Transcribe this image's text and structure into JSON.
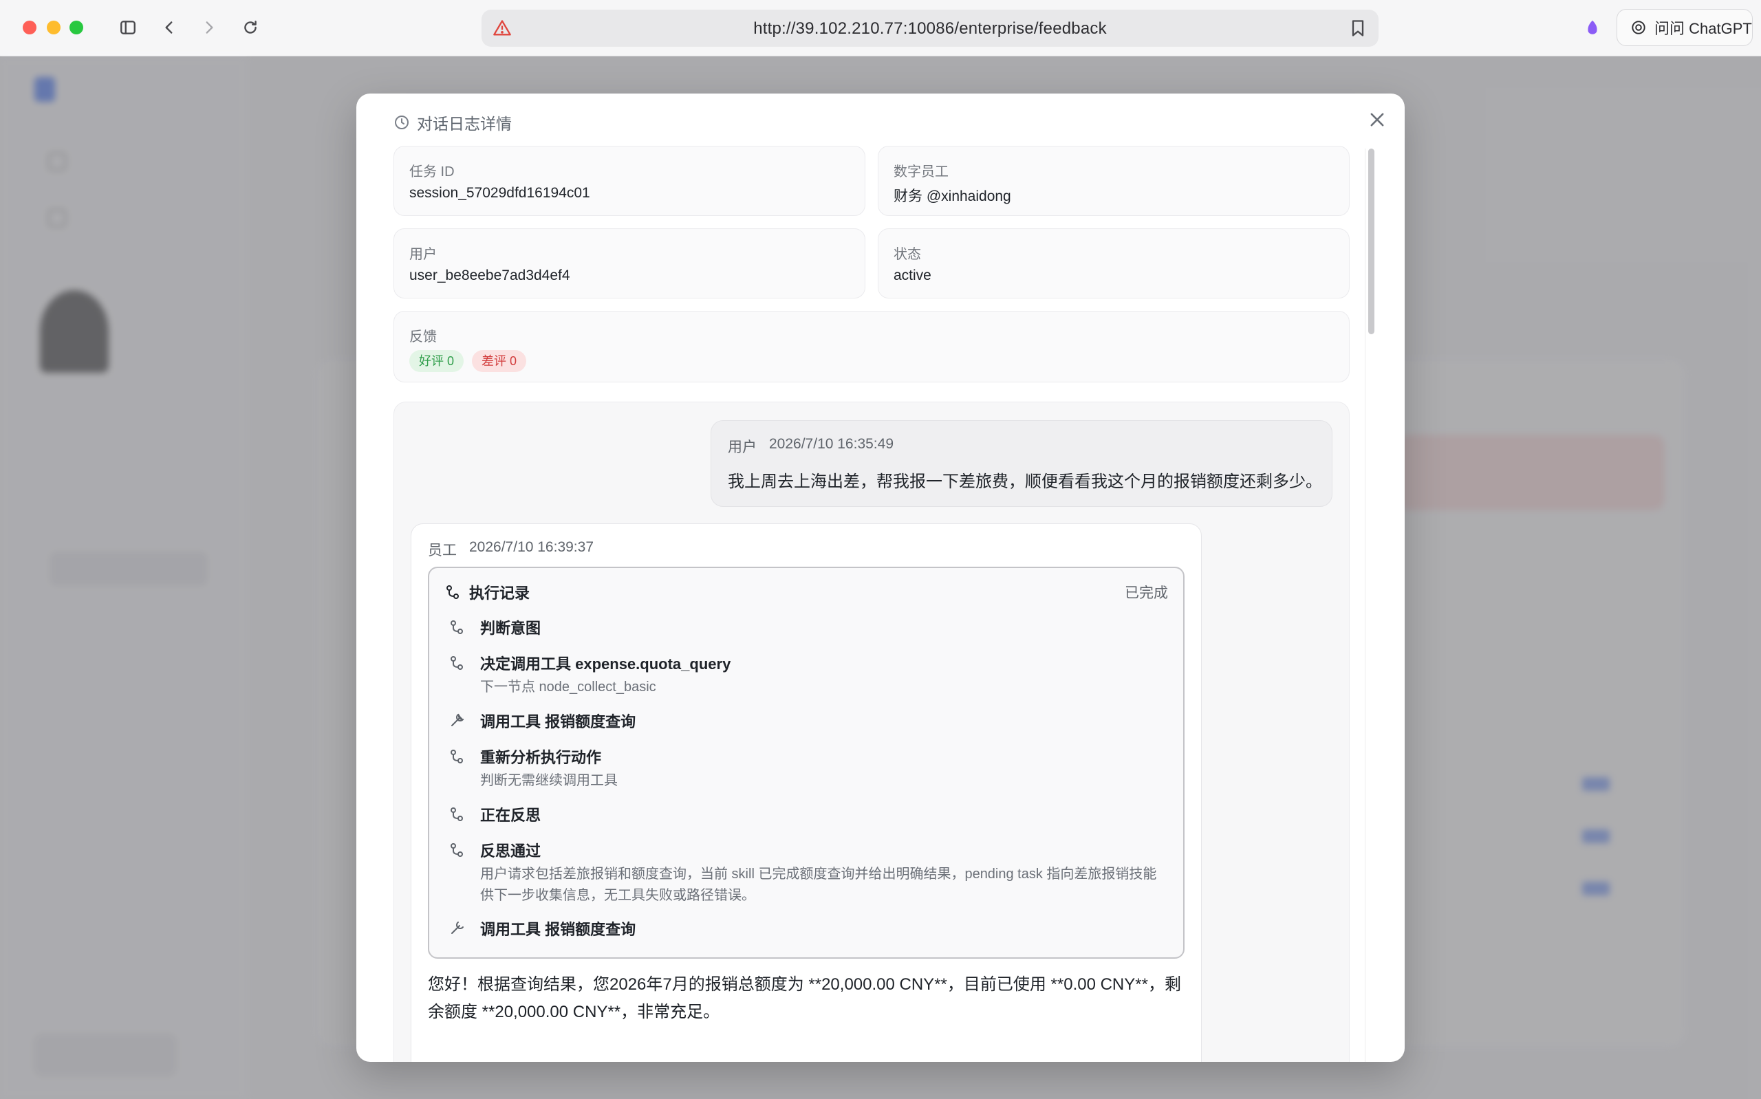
{
  "browser": {
    "url": "http://39.102.210.77:10086/enterprise/feedback",
    "chatgpt_label": "问问 ChatGPT"
  },
  "icons": {
    "sidebar_toggle": "sidebar-icon",
    "back": "chevron-left-icon",
    "forward": "chevron-right-icon",
    "reload": "reload-icon",
    "warning": "warning-triangle-icon",
    "bookmark": "bookmark-icon",
    "close": "close-icon",
    "clock": "clock-icon",
    "branch": "branch-icon",
    "wrench": "wrench-icon"
  },
  "modal": {
    "title": "对话日志详情",
    "fields": {
      "task_id_label": "任务 ID",
      "task_id_value": "session_57029dfd16194c01",
      "employee_label": "数字员工",
      "employee_value": "财务 @xinhaidong",
      "user_label": "用户",
      "user_value": "user_be8eebe7ad3d4ef4",
      "status_label": "状态",
      "status_value": "active",
      "feedback_label": "反馈",
      "good_badge": "好评 0",
      "bad_badge": "差评 0"
    },
    "user_message": {
      "role": "用户",
      "time": "2026/7/10 16:35:49",
      "text": "我上周去上海出差，帮我报一下差旅费，顺便看看我这个月的报销额度还剩多少。"
    },
    "agent_message": {
      "role": "员工",
      "time": "2026/7/10 16:39:37",
      "exec_title": "执行记录",
      "exec_status": "已完成",
      "steps": [
        {
          "icon": "branch-icon",
          "title": "判断意图",
          "desc": ""
        },
        {
          "icon": "branch-icon",
          "title": "决定调用工具 expense.quota_query",
          "desc": "下一节点 node_collect_basic"
        },
        {
          "icon": "wrench-icon",
          "title": "调用工具 报销额度查询",
          "desc": ""
        },
        {
          "icon": "branch-icon",
          "title": "重新分析执行动作",
          "desc": "判断无需继续调用工具"
        },
        {
          "icon": "branch-icon",
          "title": "正在反思",
          "desc": ""
        },
        {
          "icon": "branch-icon",
          "title": "反思通过",
          "desc": "用户请求包括差旅报销和额度查询，当前 skill 已完成额度查询并给出明确结果，pending task 指向差旅报销技能供下一步收集信息，无工具失败或路径错误。"
        },
        {
          "icon": "wrench-icon",
          "title": "调用工具 报销额度查询",
          "desc": ""
        }
      ],
      "answer": "您好！根据查询结果，您2026年7月的报销总额度为 **20,000.00 CNY**，目前已使用 **0.00 CNY**，剩余额度 **20,000.00 CNY**，非常充足。"
    }
  },
  "colors": {
    "accent": "#3b6ef5",
    "good": "#2f9e4a",
    "bad": "#d23c3c"
  }
}
